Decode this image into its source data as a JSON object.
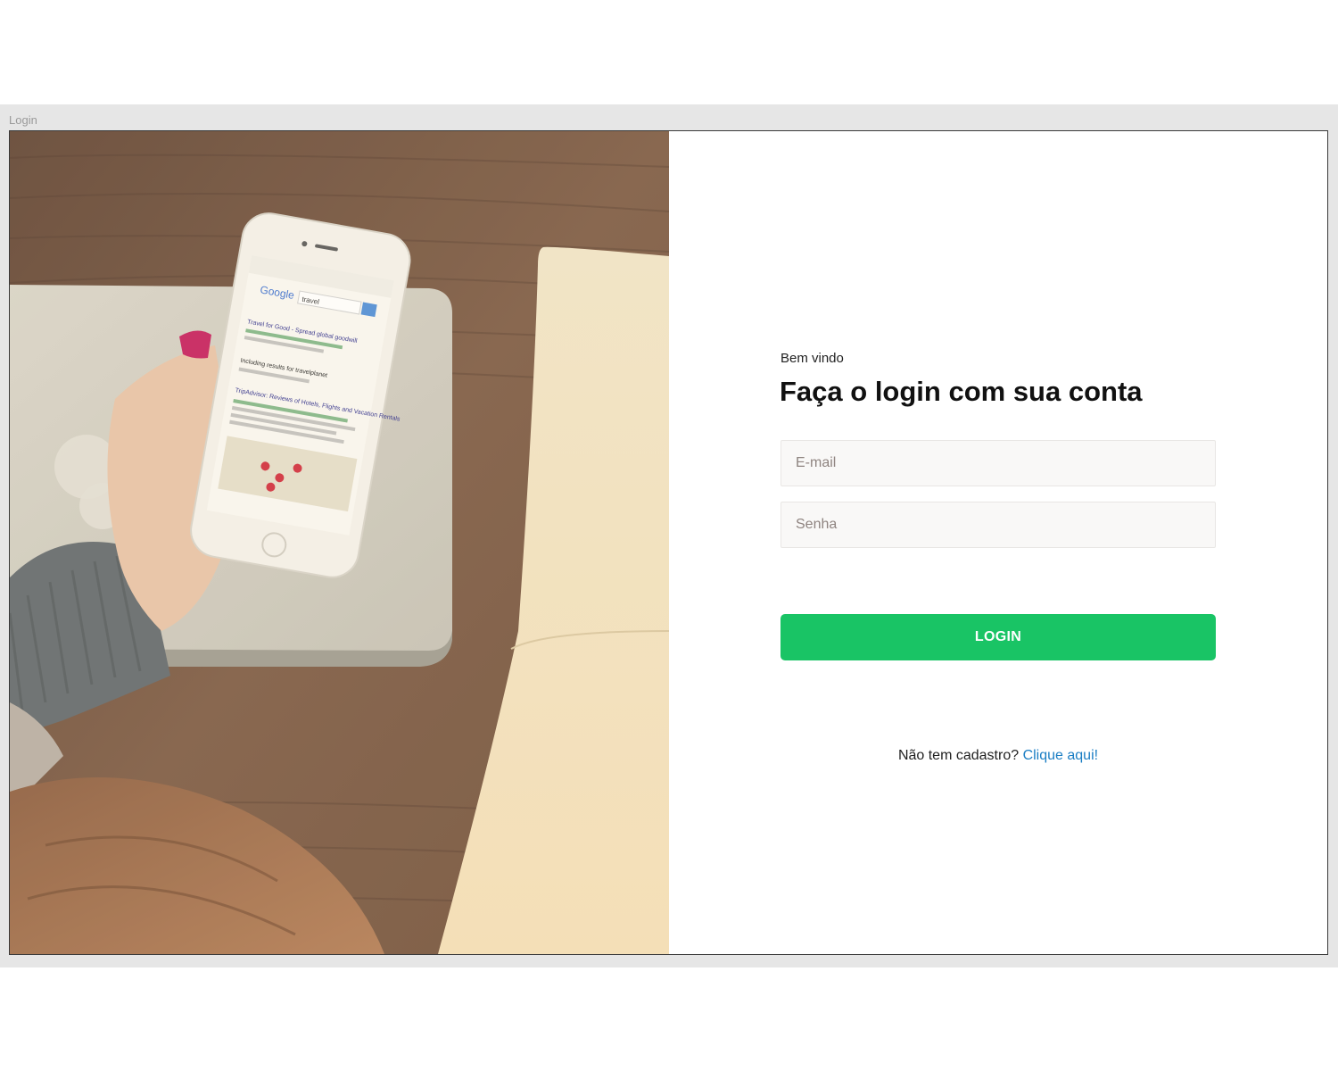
{
  "artboard": {
    "label": "Login"
  },
  "photo": {
    "phone_screen": {
      "search_query": "travel",
      "brand": "Google",
      "results": [
        "Travel for Good - Spread global goodwill",
        "Including results for travelplanet",
        "TripAdvisor: Reviews of Hotels, Flights and Vacation Rentals"
      ]
    }
  },
  "login": {
    "welcome": "Bem vindo",
    "title": "Faça o login com sua conta",
    "email_placeholder": "E-mail",
    "password_placeholder": "Senha",
    "button_label": "LOGIN",
    "signup_prompt": "Não tem cadastro?",
    "signup_link": "Clique aqui!"
  },
  "colors": {
    "accent_green": "#19c465",
    "link_blue": "#1b7ec4",
    "field_bg": "#f9f8f7"
  }
}
